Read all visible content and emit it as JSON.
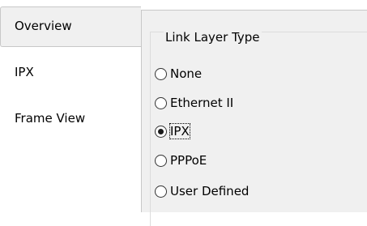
{
  "tabs": [
    {
      "label": "Overview",
      "active": true
    },
    {
      "label": "IPX",
      "active": false
    },
    {
      "label": "Frame View",
      "active": false
    }
  ],
  "group": {
    "title": "Link Layer Type",
    "options": [
      {
        "label": "None",
        "checked": false
      },
      {
        "label": "Ethernet II",
        "checked": false
      },
      {
        "label": "IPX",
        "checked": true
      },
      {
        "label": "PPPoE",
        "checked": false
      },
      {
        "label": "User Defined",
        "checked": false
      }
    ]
  }
}
